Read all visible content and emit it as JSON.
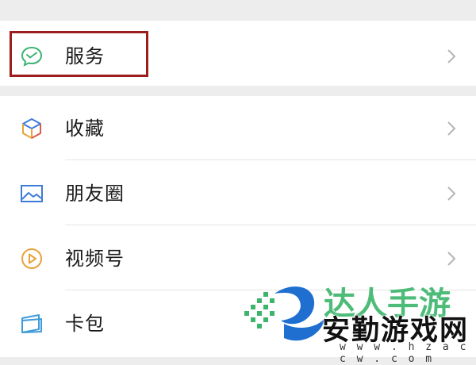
{
  "menu": {
    "items": [
      {
        "label": "服务",
        "icon": "wechat-pay-icon"
      },
      {
        "label": "收藏",
        "icon": "favorites-cube-icon"
      },
      {
        "label": "朋友圈",
        "icon": "moments-photo-icon"
      },
      {
        "label": "视频号",
        "icon": "channels-play-icon"
      },
      {
        "label": "卡包",
        "icon": "card-wallet-icon"
      }
    ]
  },
  "colors": {
    "background": "#ededed",
    "row": "#ffffff",
    "highlight": "#9b1d1d",
    "icon_green": "#3cb371",
    "icon_blue": "#3d7bd8",
    "icon_orange": "#e8a23a",
    "chevron": "#b5b5b5"
  },
  "watermark": {
    "site_name": "安勤游戏网",
    "partial_text": "达人手游",
    "url": "w w w . h z a c c w . c o m"
  }
}
